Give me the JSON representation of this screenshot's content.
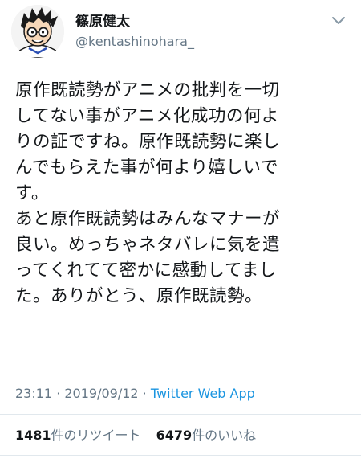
{
  "author": {
    "display_name": "篠原健太",
    "handle": "@kentashinohara_",
    "avatar_icon": "avatar-icon"
  },
  "tweet": {
    "lines": [
      "原作既読勢がアニメの批判を一切",
      "してない事がアニメ化成功の何よ",
      "りの証ですね。原作既読勢に楽し",
      "んでもらえた事が何より嬉しいで",
      "す。",
      "あと原作既読勢はみんなマナーが",
      "良い。めっちゃネタバレに気を遣",
      "ってくれてて密かに感動してまし",
      "た。ありがとう、原作既読勢。"
    ]
  },
  "meta": {
    "time": "23:11",
    "separator": " · ",
    "date": "2019/09/12",
    "separator2": " · ",
    "source": "Twitter Web App"
  },
  "stats": {
    "retweets_count": "1481",
    "retweets_label": "件のリツイート",
    "likes_count": "6479",
    "likes_label": "件のいいね"
  },
  "colors": {
    "text": "#14171a",
    "secondary": "#657786",
    "link": "#1b95e0",
    "divider": "#e1e8ed"
  }
}
